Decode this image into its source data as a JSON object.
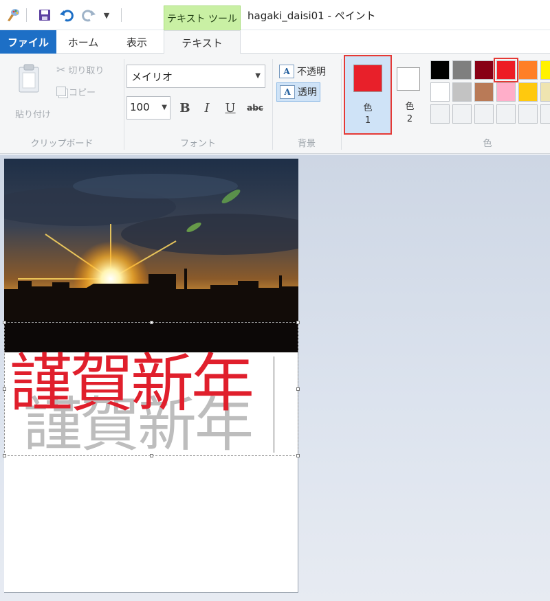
{
  "titlebar": {
    "title": "hagaki_daisi01 - ペイント",
    "context_tab": "テキスト ツール",
    "quick_access": [
      "paint-app-icon",
      "save-icon",
      "undo-icon",
      "redo-icon",
      "customize-dropdown-icon"
    ]
  },
  "tabs": {
    "file": "ファイル",
    "home": "ホーム",
    "view": "表示",
    "text": "テキスト"
  },
  "clipboard": {
    "paste": "貼り付け",
    "cut": "切り取り",
    "copy": "コピー",
    "label": "クリップボード"
  },
  "font": {
    "family": "メイリオ",
    "size": "100",
    "bold": "B",
    "italic": "I",
    "underline": "U",
    "strike": "abc",
    "label": "フォント"
  },
  "background": {
    "opaque": "不透明",
    "transparent": "透明",
    "selected": "透明",
    "label": "背景"
  },
  "colors": {
    "color1_label": "色",
    "color1_num": "1",
    "color2_label": "色",
    "color2_num": "2",
    "label": "色",
    "color1_value": "#e8202a",
    "color2_value": "#ffffff",
    "palette_row1": [
      "#000000",
      "#7f7f7f",
      "#880015",
      "#ed1c24",
      "#ff7f27",
      "#fff200"
    ],
    "palette_row2": [
      "#ffffff",
      "#c3c3c3",
      "#b97a57",
      "#ffaec9",
      "#ffc90e",
      "#efe4b0"
    ],
    "selected_palette": "#ed1c24"
  },
  "canvas": {
    "greeting_red": "謹賀新年",
    "greeting_grey": "謹賀新年"
  }
}
